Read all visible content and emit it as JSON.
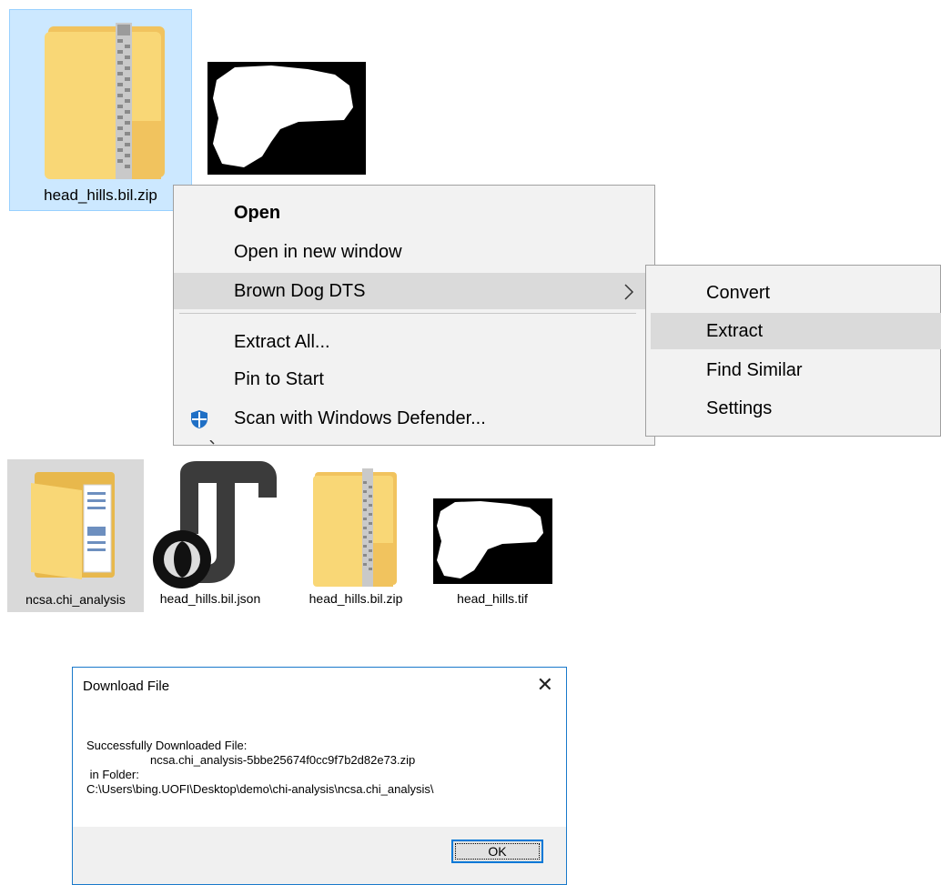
{
  "top_tiles": {
    "zip_label": "head_hills.bil.zip"
  },
  "context_menu": {
    "items": [
      "Open",
      "Open in new window",
      "Brown Dog DTS",
      "Extract All...",
      "Pin to Start",
      "Scan with Windows Defender..."
    ],
    "submenu_items": [
      "Convert",
      "Extract",
      "Find Similar",
      "Settings"
    ]
  },
  "files": [
    {
      "label": "ncsa.chi_analysis"
    },
    {
      "label": "head_hills.bil.json"
    },
    {
      "label": "head_hills.bil.zip"
    },
    {
      "label": "head_hills.tif"
    }
  ],
  "dialog": {
    "title": "Download File",
    "line1": "Successfully Downloaded File:",
    "line2": "ncsa.chi_analysis-5bbe25674f0cc9f7b2d82e73.zip",
    "line3": " in Folder:",
    "line4": "C:\\Users\\bing.UOFI\\Desktop\\demo\\chi-analysis\\ncsa.chi_analysis\\",
    "ok_label": "OK",
    "close_glyph": "✕"
  },
  "icons": {
    "zip_folder": "zip-folder-icon",
    "folder": "folder-icon",
    "json_file": "json-file-icon",
    "tif_thumbnail": "image-thumbnail-icon",
    "defender": "windows-defender-icon",
    "chevron": "chevron-right-icon"
  },
  "colors": {
    "selection_bg": "#cce8ff",
    "menu_highlight": "#dadada",
    "dialog_border": "#1979ca",
    "ok_border": "#0078d7",
    "folder_yellow": "#f9d776"
  }
}
